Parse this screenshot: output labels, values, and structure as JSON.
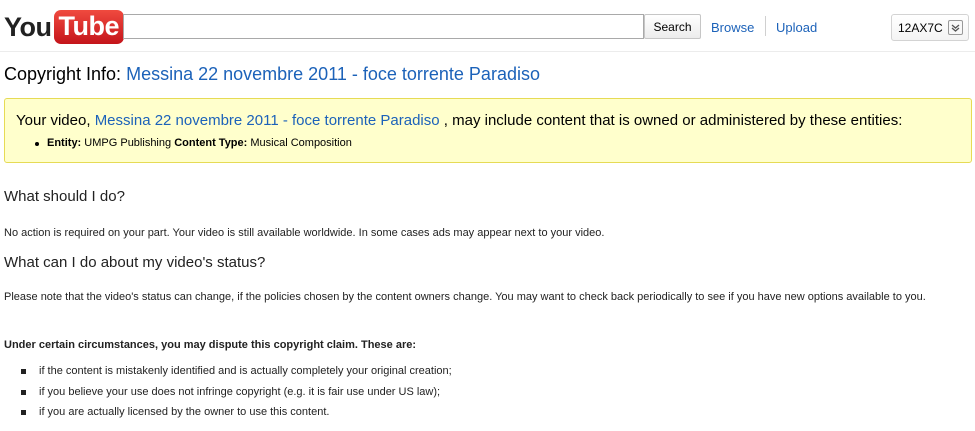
{
  "header": {
    "logo_you": "You",
    "logo_tube": "Tube",
    "search_value": "",
    "search_button": "Search",
    "nav_browse": "Browse",
    "nav_upload": "Upload",
    "username": "12AX7C",
    "user_menu_icon": "chevron-down-icon"
  },
  "title": {
    "prefix": "Copyright Info:",
    "video_title": "Messina 22 novembre 2011 - foce torrente Paradiso"
  },
  "notice": {
    "lead": "Your video,",
    "video_title": "Messina 22 novembre 2011 - foce torrente Paradiso",
    "trail": ", may include content that is owned or administered by these entities:",
    "entity_label": "Entity:",
    "entity_value": "UMPG Publishing",
    "content_type_label": "Content Type:",
    "content_type_value": "Musical Composition",
    "bg_color": "#ffffcc",
    "border_color": "#e6db55"
  },
  "section1": {
    "heading": "What should I do?",
    "text": "No action is required on your part. Your video is still available worldwide. In some cases ads may appear next to your video."
  },
  "section2": {
    "heading": "What can I do about my video's status?",
    "text": "Please note that the video's status can change, if the policies chosen by the content owners change. You may want to check back periodically to see if you have new options available to you.",
    "dispute_heading": "Under certain circumstances, you may dispute this copyright claim. These are:",
    "reasons": [
      "if the content is mistakenly identified and is actually completely your original creation;",
      "if you believe your use does not infringe copyright (e.g. it is fair use under US law);",
      "if you are actually licensed by the owner to use this content."
    ]
  },
  "colors": {
    "link": "#1c62b9",
    "logo_red": "#e02a20"
  }
}
